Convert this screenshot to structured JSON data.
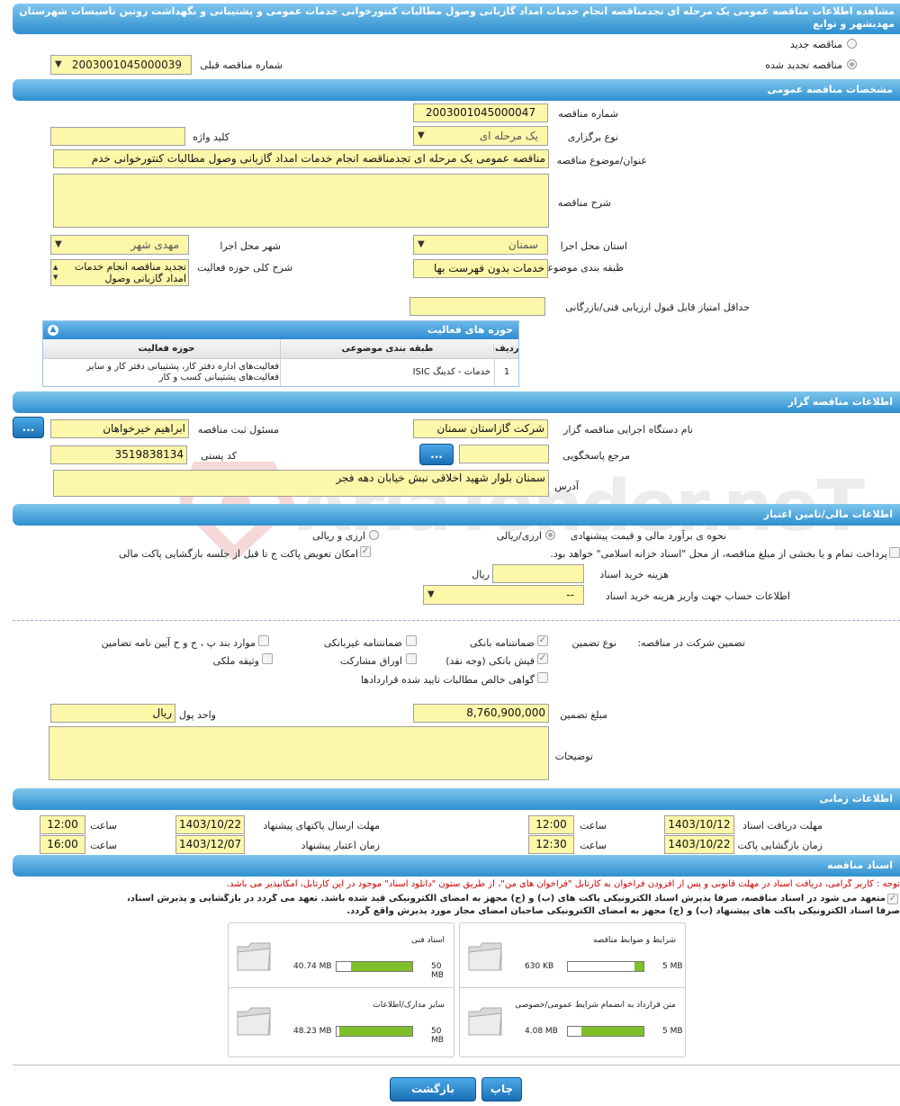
{
  "page": {
    "title": "مشاهده اطلاعات مناقصه عمومی یک مرحله ای تجدمناقصه انجام خدمات امداد گازبانی وصول مطالبات کنتورخوانی خدمات عمومی و پشتیبانی و نگهداشت روتین تاسیسات شهرستان مهدیشهر و توابع"
  },
  "watermark": "AriaTender.neT",
  "top": {
    "new_tender": "مناقصه جدید",
    "renewed_tender": "مناقصه تجدید شده",
    "prev_number_label": "شماره مناقصه قبلی",
    "prev_number_value": "2003001045000039"
  },
  "general": {
    "section_title": "مشخصات مناقصه عمومی",
    "number_label": "شماره مناقصه",
    "number_value": "2003001045000047",
    "type_label": "نوع برگزاری",
    "type_value": "یک مرحله ای",
    "keyword_label": "کلید واژه",
    "subject_label": "عنوان/موضوع مناقصه",
    "subject_value": "مناقصه عمومی یک مرحله ای تجدمناقصه انجام خدمات امداد گازبانی وصول مطالبات کنتورخوانی خدم",
    "desc_label": "شرح مناقصه",
    "province_label": "استان محل اجرا",
    "province_value": "سمنان",
    "city_label": "شهر محل اجرا",
    "city_value": "مهدی شهر",
    "category_label": "طبقه بندی موضوعی",
    "category_value": "خدمات بدون فهرست بها",
    "activity_desc_label": "شرح کلی حوزه فعالیت",
    "activity_desc_value": "تجدید مناقصه انجام خدمات امداد گازبانی وصول",
    "min_score_label": "حداقل امتیاز قابل قبول ارزیابی فنی/بازرگانی"
  },
  "activities": {
    "title": "حوزه های فعالیت",
    "col_row": "ردیف",
    "col_category": "طبقه بندی موضوعی",
    "col_field": "حوزه فعالیت",
    "rows": [
      {
        "row": "1",
        "category": "خدمات - کدینگ ISIC",
        "field": "فعالیت‌های  اداره دفتر کار، پشتیبانی دفتر کار و سایر فعالیت‌های پشتیبانی کسب و کار"
      }
    ]
  },
  "organizer": {
    "section_title": "اطلاعات مناقصه گزار",
    "org_label": "نام دستگاه اجرایی مناقصه گزار",
    "org_value": "شرکت گازاستان سمنان",
    "registrar_label": "مسئول ثبت مناقصه",
    "registrar_value": "ابراهیم خیرخواهان",
    "ref_label": "مرجع پاسخگویی",
    "postal_label": "کد پستی",
    "postal_value": "3519838134",
    "address_label": "آدرس",
    "address_value": "سمنان بلوار شهید اخلاقی نبش خیابان دهه فجر",
    "dots": "..."
  },
  "finance": {
    "section_title": "اطلاعات مالی/تامین اعتبار",
    "estimate_label": "نحوه ی برآورد مالی و قیمت پیشنهادی",
    "opt_currency": "ارزی/ریالی",
    "opt_rial": "ارزی و ریالی",
    "treasury_text": "پرداخت تمام و یا بخشی از مبلغ مناقصه، از محل \"اسناد خزانه اسلامی\" خواهد بود.",
    "swap_text": "امکان تعویض پاکت ج تا قبل از جلسه بازگشایی پاکت مالی",
    "doc_cost_label": "هزینه خرید اسناد",
    "doc_cost_unit": "ریال",
    "account_label": "اطلاعات حساب جهت واریز هزینه خرید اسناد",
    "account_value": "--"
  },
  "guarantee": {
    "label": "تضمین شرکت در مناقصه:",
    "type_label": "نوع تضمین",
    "bank": "ضمانتنامه بانکی",
    "nonbank": "ضمانتنامه غیربانکی",
    "items_pc": "موارد بند پ ، ج و ح آیین نامه تضامین",
    "cheque": "فیش بانکی (وجه نقد)",
    "bonds": "اوراق مشارکت",
    "property": "وثیقه ملکی",
    "cert": "گواهی خالص مطالبات تایید شده قراردادها",
    "amount_label": "مبلغ تضمین",
    "amount_value": "8,760,900,000",
    "unit_label": "واحد پول",
    "unit_value": "ریال",
    "notes_label": "توضیحات"
  },
  "timing": {
    "section_title": "اطلاعات زمانی",
    "receive_label": "مهلت دریافت اسناد",
    "receive_date": "1403/10/12",
    "receive_time": "12:00",
    "send_label": "مهلت ارسال پاکتهای پیشنهاد",
    "send_date": "1403/10/22",
    "send_time": "12:00",
    "open_label": "زمان بازگشایی پاکت ها",
    "open_date": "1403/10/22",
    "open_time": "12:30",
    "valid_label": "زمان اعتبار پیشنهاد",
    "valid_date": "1403/12/07",
    "valid_time": "16:00",
    "time_label": "ساعت"
  },
  "docs": {
    "section_title": "اسناد مناقصه",
    "note": "توجه : کاربر گرامی، دریافت اسناد در مهلت قانونی و پس از افزودن فراخوان به کارتابل \"فراخوان های من\"، از طریق ستون \"دانلود اسناد\" موجود در این کارتابل، امکانپذیر می باشد.",
    "commit1": "متعهد می شود در اسناد مناقصه، صرفاً پذیرش اسناد الکترونیکی پاکت های (ب) و (ج) مجهز به امضای الکترونیکی قید شده باشد. تعهد می گردد در بازگشایی و پذیرش اسناد،",
    "commit2": "صرفاً اسناد الکترونیکی پاکت های پیشنهاد (ب) و (ج) مجهز به امضای الکترونیکی صاحبان امضای مجاز مورد پذیرش واقع گردد.",
    "cards": [
      {
        "title": "شرایط و ضوابط مناقصه",
        "size": "630 KB",
        "max": "5 MB",
        "fill": 0.12
      },
      {
        "title": "اسناد فنی",
        "size": "40.74 MB",
        "max": "50 MB",
        "fill": 0.81
      },
      {
        "title": "متن قرارداد به انضمام شرایط عمومی/خصوصی",
        "size": "4.08 MB",
        "max": "5 MB",
        "fill": 0.82
      },
      {
        "title": "سایر مدارک/اطلاعات",
        "size": "48.23 MB",
        "max": "50 MB",
        "fill": 0.96
      }
    ]
  },
  "buttons": {
    "print": "چاپ",
    "back": "بازگشت"
  },
  "colors": {
    "section_bar": "#3a9ad9",
    "field_bg": "#fcf7a9",
    "progress": "#7fbf2a",
    "note_red": "#d00000"
  }
}
